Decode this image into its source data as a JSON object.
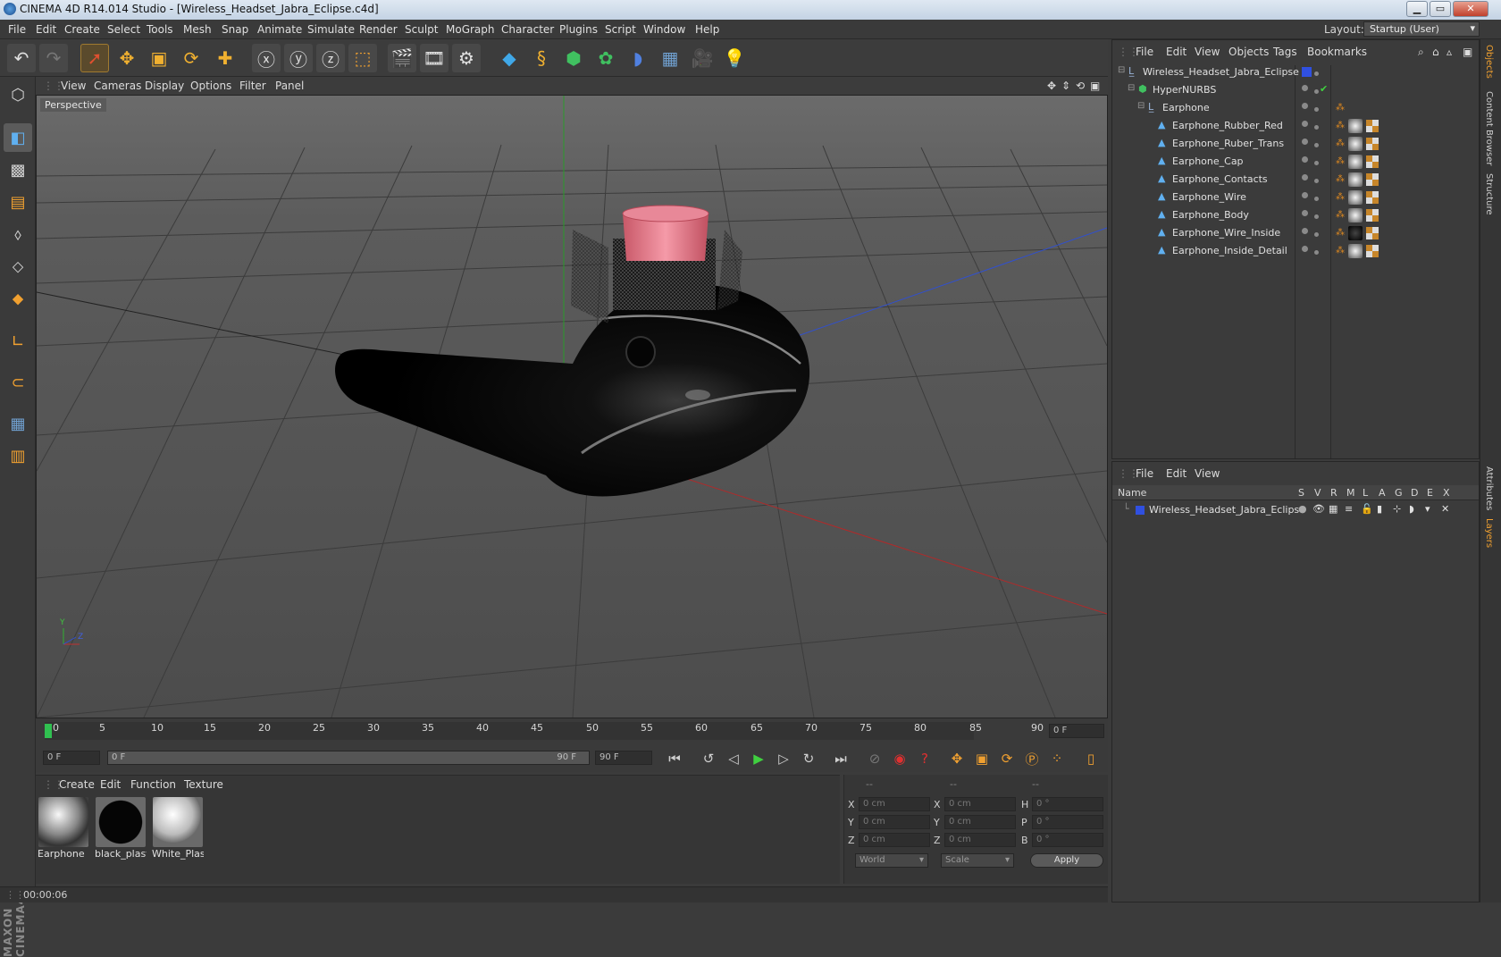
{
  "window": {
    "title": "CINEMA 4D R14.014 Studio - [Wireless_Headset_Jabra_Eclipse.c4d]",
    "min_label": "▁",
    "max_label": "▭",
    "close_label": "✕"
  },
  "menu": {
    "items": [
      "File",
      "Edit",
      "Create",
      "Select",
      "Tools",
      "Mesh",
      "Snap",
      "Animate",
      "Simulate",
      "Render",
      "Sculpt",
      "MoGraph",
      "Character",
      "Plugins",
      "Script",
      "Window",
      "Help"
    ],
    "layout_label": "Layout:",
    "layout_value": "Startup (User)"
  },
  "viewport": {
    "menu": [
      "View",
      "Cameras",
      "Display",
      "Options",
      "Filter",
      "Panel"
    ],
    "label": "Perspective",
    "axis_y": "Y",
    "axis_z": "Z",
    "colors": {
      "x_axis": "#c03030",
      "y_axis": "#30b030",
      "z_axis": "#3050d0",
      "earphone": "#0a0a0a",
      "cap": "#e07080"
    }
  },
  "timeline": {
    "ticks": [
      "0",
      "5",
      "10",
      "15",
      "20",
      "25",
      "30",
      "35",
      "40",
      "45",
      "50",
      "55",
      "60",
      "65",
      "70",
      "75",
      "80",
      "85",
      "90"
    ],
    "current_frame": "0 F",
    "start_field": "0 F",
    "range_start": "0 F",
    "range_end": "90 F",
    "end_field": "90 F"
  },
  "materials": {
    "menu": [
      "Create",
      "Edit",
      "Function",
      "Texture"
    ],
    "items": [
      {
        "name": "Earphone"
      },
      {
        "name": "black_plast"
      },
      {
        "name": "White_Plas"
      }
    ]
  },
  "coords": {
    "header": [
      "--",
      "--",
      "--"
    ],
    "rows": [
      {
        "a": "X",
        "av": "0 cm",
        "b": "X",
        "bv": "0 cm",
        "c": "H",
        "cv": "0 °"
      },
      {
        "a": "Y",
        "av": "0 cm",
        "b": "Y",
        "bv": "0 cm",
        "c": "P",
        "cv": "0 °"
      },
      {
        "a": "Z",
        "av": "0 cm",
        "b": "Z",
        "bv": "0 cm",
        "c": "B",
        "cv": "0 °"
      }
    ],
    "space": "World",
    "mode": "Scale",
    "apply": "Apply"
  },
  "status": {
    "time": "00:00:06"
  },
  "objects": {
    "menu": [
      "File",
      "Edit",
      "View",
      "Objects",
      "Tags",
      "Bookmarks"
    ],
    "tree": [
      {
        "name": "Wireless_Headset_Jabra_Eclipse",
        "indent": 0,
        "icon": "null-icon"
      },
      {
        "name": "HyperNURBS",
        "indent": 1,
        "icon": "hypernurbs-icon"
      },
      {
        "name": "Earphone",
        "indent": 2,
        "icon": "null-icon"
      },
      {
        "name": "Earphone_Rubber_Red",
        "indent": 3,
        "icon": "polygon-icon"
      },
      {
        "name": "Earphone_Ruber_Trans",
        "indent": 3,
        "icon": "polygon-icon"
      },
      {
        "name": "Earphone_Cap",
        "indent": 3,
        "icon": "polygon-icon"
      },
      {
        "name": "Earphone_Contacts",
        "indent": 3,
        "icon": "polygon-icon"
      },
      {
        "name": "Earphone_Wire",
        "indent": 3,
        "icon": "polygon-icon"
      },
      {
        "name": "Earphone_Body",
        "indent": 3,
        "icon": "polygon-icon"
      },
      {
        "name": "Earphone_Wire_Inside",
        "indent": 3,
        "icon": "polygon-icon"
      },
      {
        "name": "Earphone_Inside_Detail",
        "indent": 3,
        "icon": "polygon-icon"
      }
    ]
  },
  "layers": {
    "menu": [
      "File",
      "Edit",
      "View"
    ],
    "header_name": "Name",
    "header_cols": [
      "S",
      "V",
      "R",
      "M",
      "L",
      "A",
      "G",
      "D",
      "E",
      "X"
    ],
    "rows": [
      {
        "name": "Wireless_Headset_Jabra_Eclipse",
        "color": "#3050e0"
      }
    ]
  },
  "right_tabs": [
    "Objects",
    "Content Browser",
    "Structure",
    "Attributes",
    "Layers"
  ]
}
